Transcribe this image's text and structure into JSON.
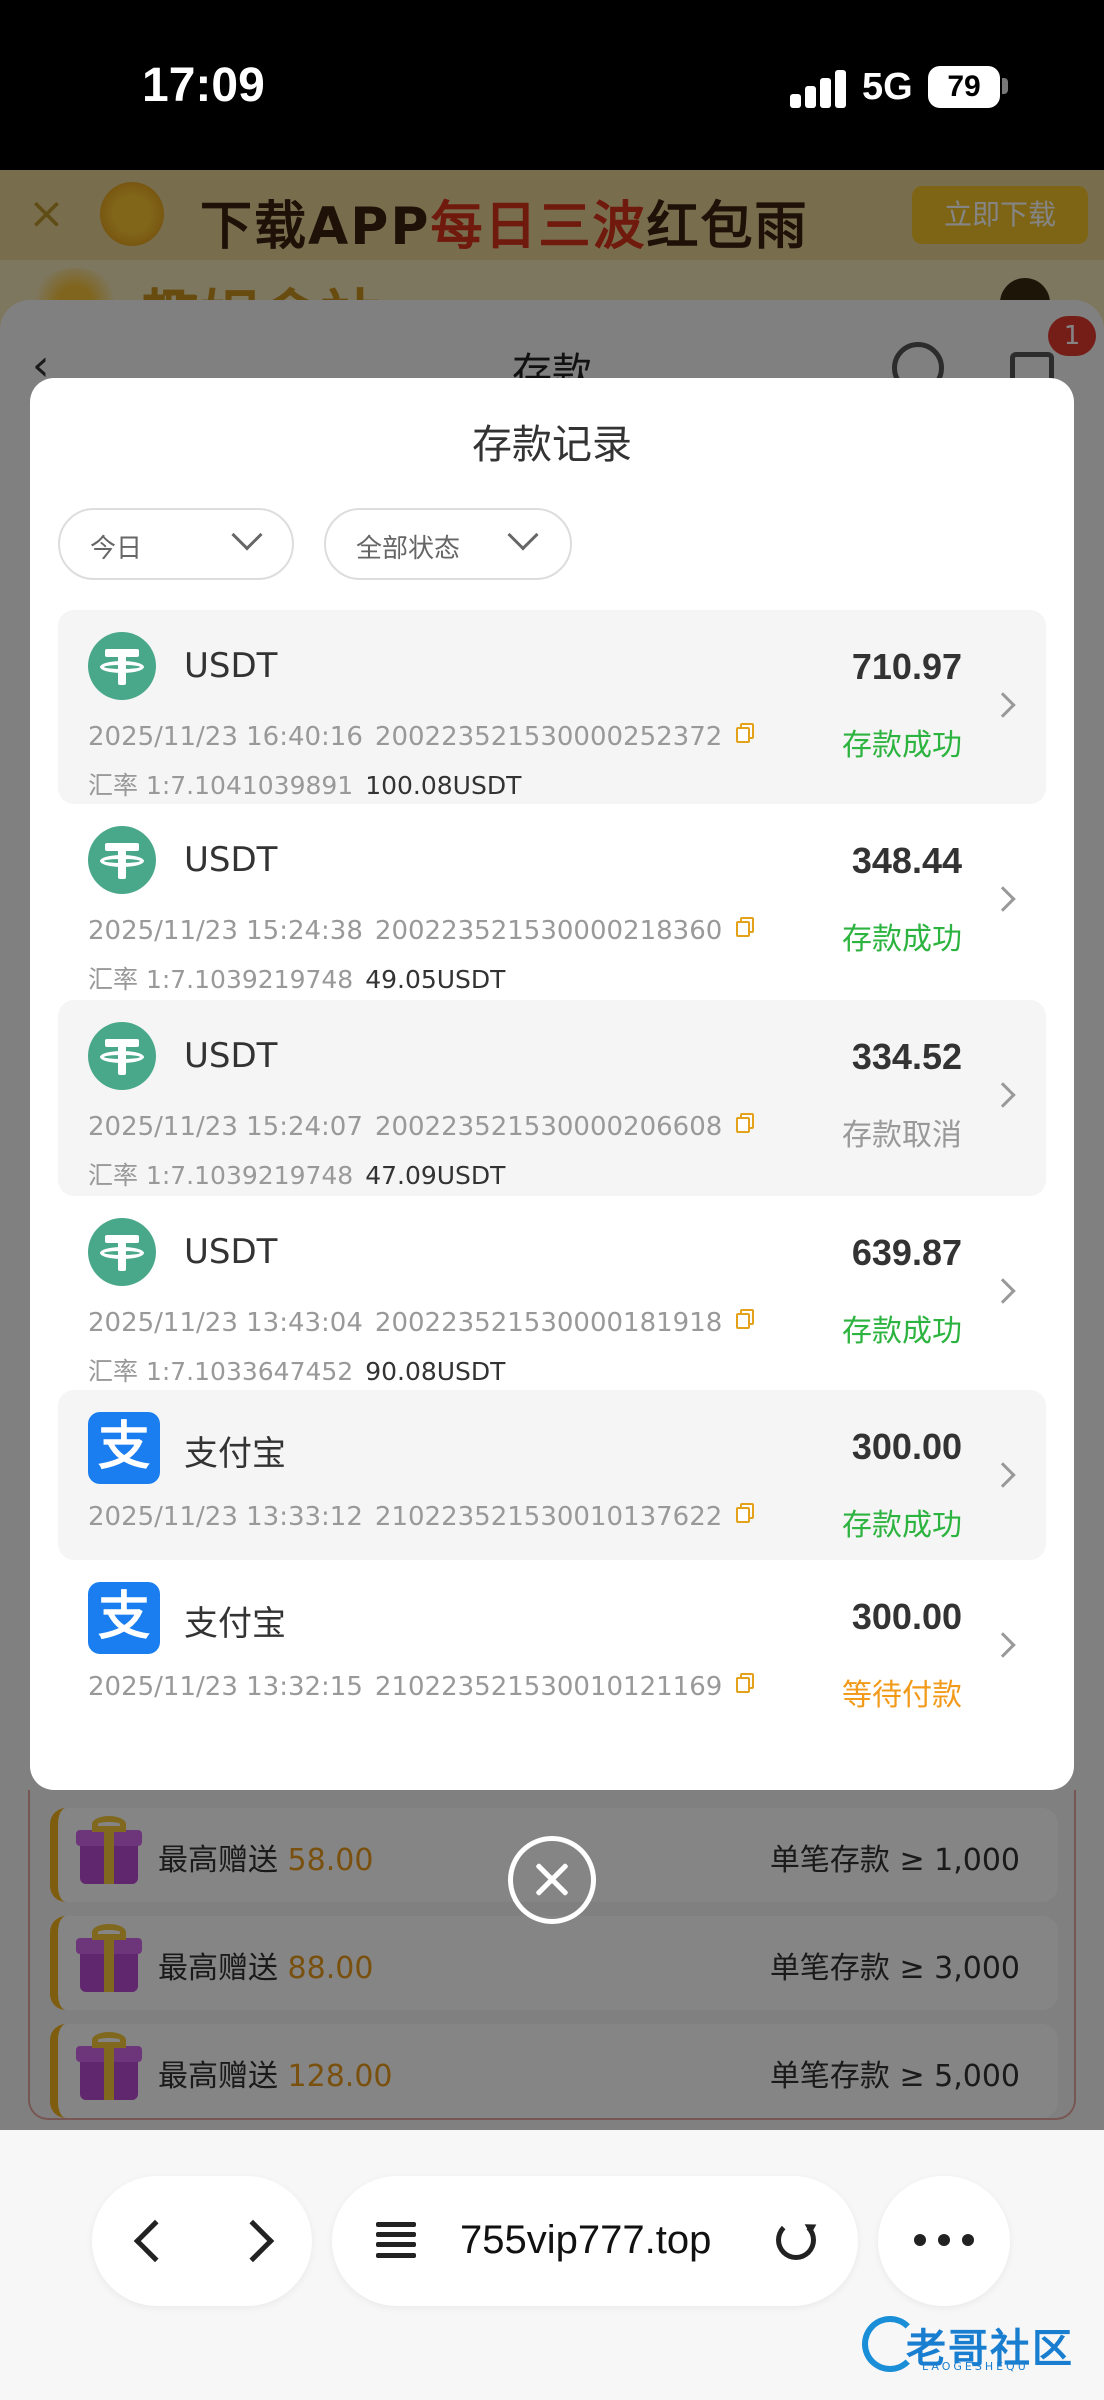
{
  "status_bar": {
    "time": "17:09",
    "network": "5G",
    "battery": "79"
  },
  "background": {
    "banner_text_a": "下载APP",
    "banner_text_b": "每日三波",
    "banner_text_c": "红包雨",
    "banner_button": "立即下载",
    "logo_text": "趣娱盒站",
    "sheet_title": "存款",
    "badge_count": "1",
    "bonus_prefix": "最高赠送",
    "bonus_rows": [
      {
        "amount": "58.00",
        "condition": "单笔存款 ≥ 1,000"
      },
      {
        "amount": "88.00",
        "condition": "单笔存款 ≥ 3,000"
      },
      {
        "amount": "128.00",
        "condition": "单笔存款 ≥ 5,000"
      }
    ]
  },
  "modal": {
    "title": "存款记录",
    "filters": {
      "date": "今日",
      "status": "全部状态"
    },
    "records": [
      {
        "method": "USDT",
        "amount": "710.97",
        "time": "2025/11/23 16:40:16",
        "order": "200223521530000252372",
        "status": "存款成功",
        "rate": "汇率 1:7.1041039891",
        "usdt": "100.08USDT"
      },
      {
        "method": "USDT",
        "amount": "348.44",
        "time": "2025/11/23 15:24:38",
        "order": "200223521530000218360",
        "status": "存款成功",
        "rate": "汇率 1:7.1039219748",
        "usdt": "49.05USDT"
      },
      {
        "method": "USDT",
        "amount": "334.52",
        "time": "2025/11/23 15:24:07",
        "order": "200223521530000206608",
        "status": "存款取消",
        "rate": "汇率 1:7.1039219748",
        "usdt": "47.09USDT"
      },
      {
        "method": "USDT",
        "amount": "639.87",
        "time": "2025/11/23 13:43:04",
        "order": "200223521530000181918",
        "status": "存款成功",
        "rate": "汇率 1:7.1033647452",
        "usdt": "90.08USDT"
      },
      {
        "method": "支付宝",
        "amount": "300.00",
        "time": "2025/11/23 13:33:12",
        "order": "210223521530010137622",
        "status": "存款成功"
      },
      {
        "method": "支付宝",
        "amount": "300.00",
        "time": "2025/11/23 13:32:15",
        "order": "210223521530010121169",
        "status": "等待付款"
      }
    ]
  },
  "browser": {
    "url": "755vip777.top"
  },
  "watermark": {
    "text": "老哥社区",
    "sub": "LAOGESHEQU"
  },
  "colors": {
    "success": "#2db33f",
    "pending": "#f29b1b",
    "cancelled": "#999999",
    "usdt_icon": "#4aa88a",
    "alipay_icon": "#1a7ef0"
  }
}
